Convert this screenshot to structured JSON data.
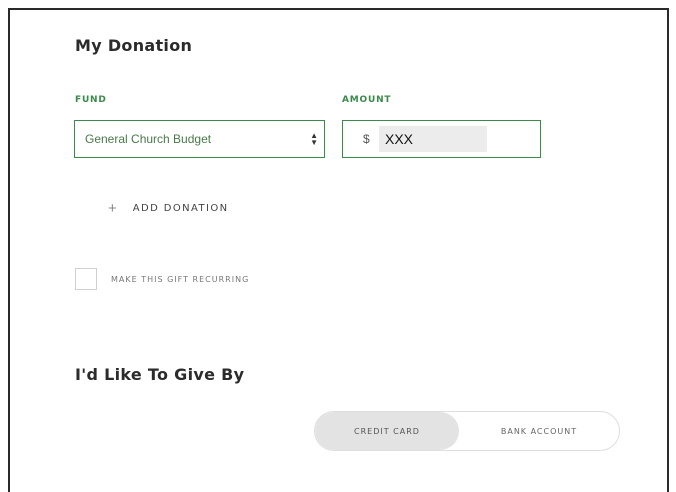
{
  "donation": {
    "title": "My Donation",
    "fund_label": "FUND",
    "amount_label": "AMOUNT",
    "fund_selected": "General Church Budget",
    "currency_symbol": "$",
    "amount_value": "XXX",
    "add_donation_label": "ADD DONATION",
    "recurring_label": "MAKE THIS GIFT RECURRING",
    "recurring_checked": false
  },
  "payment": {
    "title": "I'd Like To Give By",
    "options": [
      "CREDIT CARD",
      "BANK ACCOUNT"
    ],
    "selected": "CREDIT CARD"
  },
  "colors": {
    "accent_green": "#3a8a4a",
    "toggle_active": "#e3e3e3"
  },
  "icons": {
    "add": "plus-icon",
    "select": "select-arrows-icon"
  }
}
